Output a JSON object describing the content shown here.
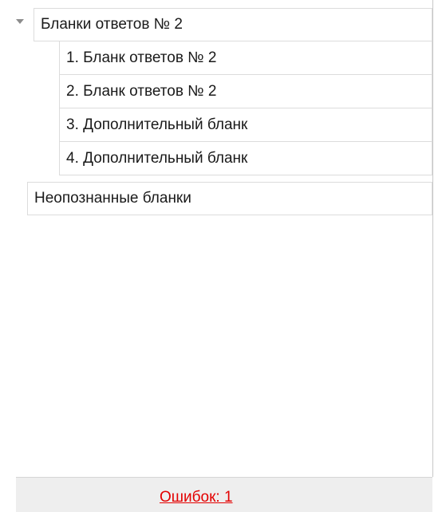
{
  "tree": {
    "group": {
      "label": "Бланки ответов № 2",
      "expanded": true,
      "children": [
        "1. Бланк ответов № 2",
        "2. Бланк ответов № 2",
        "3. Дополнительный бланк",
        "4. Дополнительный бланк"
      ]
    },
    "unrecognized_label": "Неопознанные бланки"
  },
  "status": {
    "errors_text": "Ошибок: 1",
    "errors_color": "#e30000"
  },
  "icons": {
    "expander": "chevron-down-icon"
  }
}
